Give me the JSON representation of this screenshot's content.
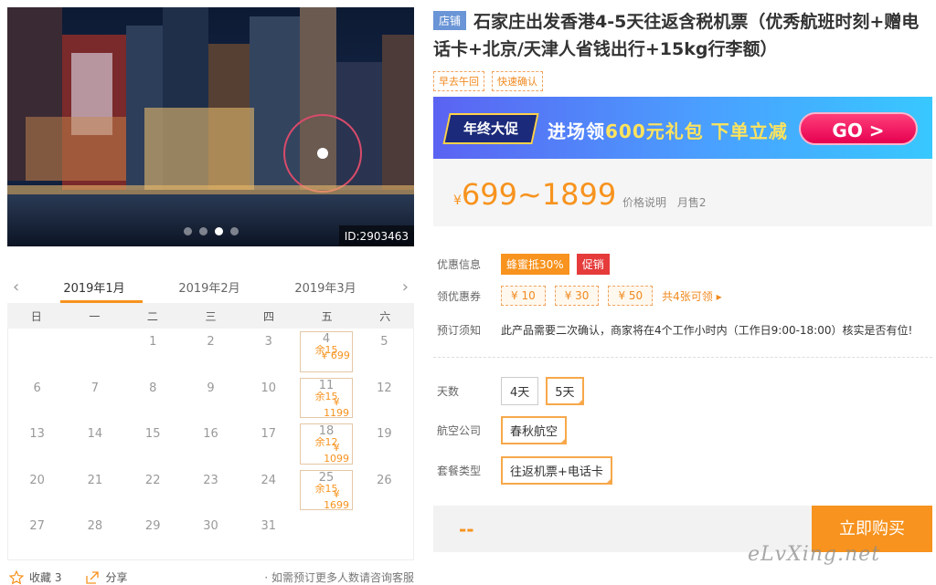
{
  "hero": {
    "id_label": "ID:2903463",
    "dots": 4,
    "active_dot": 2
  },
  "calendar": {
    "months": [
      "2019年1月",
      "2019年2月",
      "2019年3月"
    ],
    "selected_month": 0,
    "weekdays": [
      "日",
      "一",
      "二",
      "三",
      "四",
      "五",
      "六"
    ],
    "rows": [
      [
        {
          "d": ""
        },
        {
          "d": ""
        },
        {
          "d": "1"
        },
        {
          "d": "2"
        },
        {
          "d": "3"
        },
        {
          "d": "4",
          "p": "¥ 699",
          "r": "余15"
        },
        {
          "d": "5"
        }
      ],
      [
        {
          "d": "6"
        },
        {
          "d": "7"
        },
        {
          "d": "8"
        },
        {
          "d": "9"
        },
        {
          "d": "10"
        },
        {
          "d": "11",
          "p": "¥ 1199",
          "r": "余15"
        },
        {
          "d": "12"
        }
      ],
      [
        {
          "d": "13"
        },
        {
          "d": "14"
        },
        {
          "d": "15"
        },
        {
          "d": "16"
        },
        {
          "d": "17"
        },
        {
          "d": "18",
          "p": "¥ 1099",
          "r": "余12"
        },
        {
          "d": "19"
        }
      ],
      [
        {
          "d": "20"
        },
        {
          "d": "21"
        },
        {
          "d": "22"
        },
        {
          "d": "23"
        },
        {
          "d": "24"
        },
        {
          "d": "25",
          "p": "¥ 1699",
          "r": "余15"
        },
        {
          "d": "26"
        }
      ],
      [
        {
          "d": "27"
        },
        {
          "d": "28"
        },
        {
          "d": "29"
        },
        {
          "d": "30"
        },
        {
          "d": "31"
        },
        {
          "d": ""
        },
        {
          "d": ""
        }
      ]
    ]
  },
  "footer": {
    "fav_label": "收藏 3",
    "share_label": "分享",
    "note": "· 如需预订更多人数请咨询客服"
  },
  "product": {
    "shop_tag": "店铺",
    "title": "石家庄出发香港4-5天往返含税机票（优秀航班时刻+赠电话卡+北京/天津人省钱出行+15kg行李额）",
    "tags": [
      "早去午回",
      "快速确认"
    ]
  },
  "promo": {
    "badge": "年终大促",
    "text_a": "进场领",
    "text_b": "600元礼包",
    "text_c": " 下单立减",
    "go": "GO >"
  },
  "price": {
    "currency": "¥",
    "range": "699~1899",
    "explain": "价格说明",
    "sold": "月售2"
  },
  "offers": {
    "discount_label": "优惠信息",
    "discount_badge": "蜂蜜抵30%",
    "promo_badge": "促销",
    "coupon_label": "领优惠券",
    "coupons": [
      "¥ 10",
      "¥ 30",
      "¥ 50"
    ],
    "coupon_more": "共4张可领 ▸",
    "notice_label": "预订须知",
    "notice_text": "此产品需要二次确认，商家将在4个工作小时内（工作日9:00-18:00）核实是否有位!"
  },
  "options": {
    "days_label": "天数",
    "days": [
      "4天",
      "5天"
    ],
    "days_selected": 1,
    "airline_label": "航空公司",
    "airlines": [
      "春秋航空"
    ],
    "package_label": "套餐类型",
    "packages": [
      "往返机票+电话卡"
    ]
  },
  "buy": {
    "price_placeholder": "--",
    "button": "立即购买"
  },
  "watermark": "eLvXing.net"
}
